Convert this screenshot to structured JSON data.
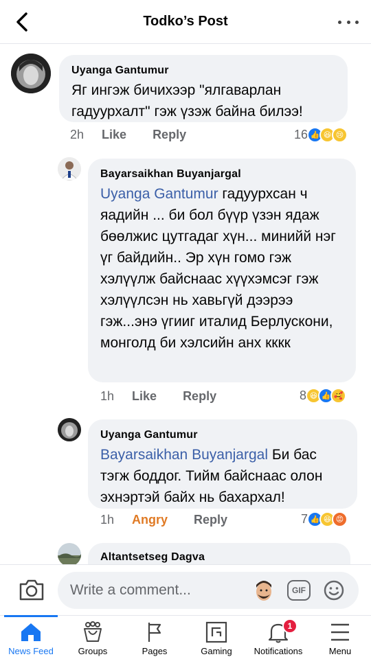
{
  "header": {
    "title": "Todko’s Post"
  },
  "comments": [
    {
      "author": "Uyanga Gantumur",
      "text": "Яг ингэж бичихээр \"ялгаварлан гадуурхалт\" гэж үзэж байна билээ!",
      "mention": "",
      "time": "2h",
      "action1": "Like",
      "action2": "Reply",
      "reaction_count": "16",
      "reactions": [
        "like",
        "haha",
        "sad"
      ]
    },
    {
      "author": "Bayarsaikhan Buyanjargal",
      "mention": "Uyanga Gantumur",
      "text": " гадуурхсан ч яадийн ... би бол бүүр үзэн ядаж бөөлжис цутгадаг хүн... минийй нэг үг байдийн.. Эр хүн гомо гэж хэлүүлж байснаас хүүхэмсэг гэж хэлүүлсэн нь хавьгүй дээрээ гэж...энэ үгииг италид Берлускони, монголд би хэлсийн анх кккк",
      "time": "1h",
      "action1": "Like",
      "action2": "Reply",
      "reaction_count": "8",
      "reactions": [
        "haha",
        "like",
        "care"
      ]
    },
    {
      "author": "Uyanga Gantumur",
      "mention": "Bayarsaikhan Buyanjargal",
      "text": " Би бас тэгж боддог. Тийм байснаас олон эхнэртэй байх нь бахархал!",
      "time": "1h",
      "action1": "Angry",
      "action2": "Reply",
      "reaction_count": "7",
      "reactions": [
        "like",
        "haha",
        "angry"
      ]
    },
    {
      "author": "Altantsetseg Dagva"
    }
  ],
  "composer": {
    "placeholder": "Write a comment...",
    "gif_label": "GIF"
  },
  "tabs": [
    {
      "label": "News Feed",
      "icon": "home-icon",
      "active": true
    },
    {
      "label": "Groups",
      "icon": "groups-icon"
    },
    {
      "label": "Pages",
      "icon": "flag-icon"
    },
    {
      "label": "Gaming",
      "icon": "gaming-icon"
    },
    {
      "label": "Notifications",
      "icon": "bell-icon",
      "badge": "1"
    },
    {
      "label": "Menu",
      "icon": "menu-icon"
    }
  ],
  "colors": {
    "accent": "#1877f2",
    "mention": "#3b5fa8",
    "angry": "#e07a24",
    "badge": "#e41e3f"
  }
}
